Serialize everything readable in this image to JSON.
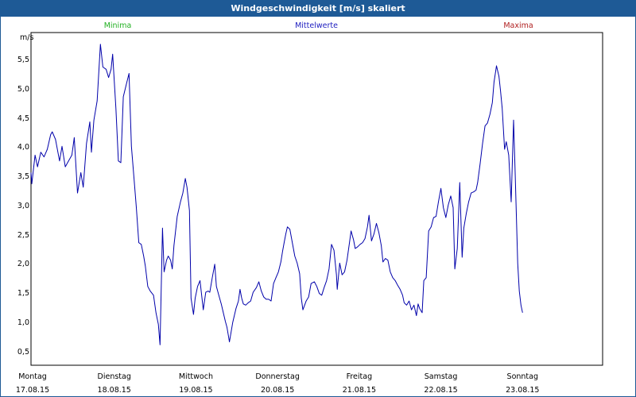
{
  "chart_data": {
    "type": "line",
    "title": "Windgeschwindigkeit [m/s] skaliert",
    "ylabel": "m/s",
    "ylim": [
      0.25,
      5.95
    ],
    "yticks": [
      0.5,
      1.0,
      1.5,
      2.0,
      2.5,
      3.0,
      3.5,
      4.0,
      4.5,
      5.0,
      5.5
    ],
    "ytick_labels": [
      "0,5",
      "1,0",
      "1,5",
      "2,0",
      "2,5",
      "3,0",
      "3,5",
      "4,0",
      "4,5",
      "5,0",
      "5,5"
    ],
    "xlim": [
      0,
      7
    ],
    "x_ticks": [
      {
        "day": "Montag",
        "date": "17.08.15"
      },
      {
        "day": "Dienstag",
        "date": "18.08.15"
      },
      {
        "day": "Mittwoch",
        "date": "19.08.15"
      },
      {
        "day": "Donnerstag",
        "date": "20.08.15"
      },
      {
        "day": "Freitag",
        "date": "21.08.15"
      },
      {
        "day": "Samstag",
        "date": "22.08.15"
      },
      {
        "day": "Sonntag",
        "date": "23.08.15"
      }
    ],
    "legend": [
      {
        "label": "Minima",
        "color": "#22b022"
      },
      {
        "label": "Mittelwerte",
        "color": "#2020c0"
      },
      {
        "label": "Maxima",
        "color": "#b02020"
      }
    ],
    "grid": true,
    "series": [
      {
        "name": "Mittelwerte",
        "color": "#0000aa",
        "points": [
          [
            0.0,
            3.55
          ],
          [
            0.01,
            3.36
          ],
          [
            0.05,
            3.85
          ],
          [
            0.08,
            3.65
          ],
          [
            0.12,
            3.9
          ],
          [
            0.16,
            3.82
          ],
          [
            0.2,
            3.95
          ],
          [
            0.24,
            4.2
          ],
          [
            0.26,
            4.25
          ],
          [
            0.3,
            4.12
          ],
          [
            0.35,
            3.75
          ],
          [
            0.38,
            4.0
          ],
          [
            0.42,
            3.65
          ],
          [
            0.46,
            3.75
          ],
          [
            0.5,
            3.85
          ],
          [
            0.53,
            4.15
          ],
          [
            0.57,
            3.2
          ],
          [
            0.61,
            3.55
          ],
          [
            0.64,
            3.3
          ],
          [
            0.68,
            4.05
          ],
          [
            0.72,
            4.42
          ],
          [
            0.74,
            3.9
          ],
          [
            0.77,
            4.45
          ],
          [
            0.81,
            4.78
          ],
          [
            0.85,
            5.75
          ],
          [
            0.88,
            5.36
          ],
          [
            0.92,
            5.32
          ],
          [
            0.95,
            5.18
          ],
          [
            0.98,
            5.32
          ],
          [
            1.0,
            5.58
          ],
          [
            1.04,
            4.65
          ],
          [
            1.07,
            3.75
          ],
          [
            1.1,
            3.72
          ],
          [
            1.13,
            4.85
          ],
          [
            1.17,
            5.08
          ],
          [
            1.2,
            5.25
          ],
          [
            1.23,
            4.0
          ],
          [
            1.26,
            3.48
          ],
          [
            1.29,
            2.95
          ],
          [
            1.32,
            2.35
          ],
          [
            1.35,
            2.32
          ],
          [
            1.38,
            2.12
          ],
          [
            1.4,
            1.95
          ],
          [
            1.43,
            1.6
          ],
          [
            1.46,
            1.52
          ],
          [
            1.5,
            1.45
          ],
          [
            1.53,
            1.15
          ],
          [
            1.56,
            0.95
          ],
          [
            1.58,
            0.6
          ],
          [
            1.61,
            2.6
          ],
          [
            1.63,
            1.85
          ],
          [
            1.66,
            2.05
          ],
          [
            1.68,
            2.12
          ],
          [
            1.71,
            2.05
          ],
          [
            1.73,
            1.9
          ],
          [
            1.75,
            2.3
          ],
          [
            1.79,
            2.8
          ],
          [
            1.83,
            3.05
          ],
          [
            1.86,
            3.2
          ],
          [
            1.89,
            3.45
          ],
          [
            1.91,
            3.3
          ],
          [
            1.94,
            2.9
          ],
          [
            1.96,
            1.4
          ],
          [
            1.99,
            1.12
          ],
          [
            2.01,
            1.4
          ],
          [
            2.04,
            1.6
          ],
          [
            2.07,
            1.7
          ],
          [
            2.11,
            1.2
          ],
          [
            2.14,
            1.5
          ],
          [
            2.17,
            1.52
          ],
          [
            2.19,
            1.5
          ],
          [
            2.22,
            1.75
          ],
          [
            2.25,
            1.98
          ],
          [
            2.27,
            1.6
          ],
          [
            2.3,
            1.45
          ],
          [
            2.33,
            1.3
          ],
          [
            2.36,
            1.12
          ],
          [
            2.38,
            1.0
          ],
          [
            2.4,
            0.9
          ],
          [
            2.43,
            0.65
          ],
          [
            2.47,
            0.98
          ],
          [
            2.51,
            1.22
          ],
          [
            2.54,
            1.35
          ],
          [
            2.56,
            1.55
          ],
          [
            2.58,
            1.4
          ],
          [
            2.6,
            1.3
          ],
          [
            2.63,
            1.28
          ],
          [
            2.66,
            1.32
          ],
          [
            2.69,
            1.35
          ],
          [
            2.72,
            1.5
          ],
          [
            2.76,
            1.58
          ],
          [
            2.79,
            1.68
          ],
          [
            2.82,
            1.52
          ],
          [
            2.85,
            1.42
          ],
          [
            2.88,
            1.38
          ],
          [
            2.91,
            1.38
          ],
          [
            2.94,
            1.35
          ],
          [
            2.97,
            1.65
          ],
          [
            3.0,
            1.75
          ],
          [
            3.03,
            1.85
          ],
          [
            3.06,
            2.02
          ],
          [
            3.08,
            2.2
          ],
          [
            3.1,
            2.35
          ],
          [
            3.12,
            2.5
          ],
          [
            3.14,
            2.62
          ],
          [
            3.17,
            2.58
          ],
          [
            3.2,
            2.35
          ],
          [
            3.23,
            2.12
          ],
          [
            3.26,
            2.0
          ],
          [
            3.29,
            1.82
          ],
          [
            3.31,
            1.4
          ],
          [
            3.33,
            1.2
          ],
          [
            3.37,
            1.35
          ],
          [
            3.4,
            1.42
          ],
          [
            3.43,
            1.65
          ],
          [
            3.47,
            1.68
          ],
          [
            3.5,
            1.6
          ],
          [
            3.53,
            1.48
          ],
          [
            3.56,
            1.45
          ],
          [
            3.59,
            1.58
          ],
          [
            3.62,
            1.7
          ],
          [
            3.65,
            1.9
          ],
          [
            3.68,
            2.32
          ],
          [
            3.71,
            2.22
          ],
          [
            3.74,
            1.8
          ],
          [
            3.75,
            1.55
          ],
          [
            3.78,
            2.0
          ],
          [
            3.81,
            1.8
          ],
          [
            3.84,
            1.85
          ],
          [
            3.87,
            2.05
          ],
          [
            3.9,
            2.35
          ],
          [
            3.92,
            2.55
          ],
          [
            3.95,
            2.4
          ],
          [
            3.97,
            2.25
          ],
          [
            4.0,
            2.28
          ],
          [
            4.03,
            2.32
          ],
          [
            4.06,
            2.35
          ],
          [
            4.09,
            2.42
          ],
          [
            4.12,
            2.62
          ],
          [
            4.14,
            2.82
          ],
          [
            4.17,
            2.38
          ],
          [
            4.2,
            2.5
          ],
          [
            4.23,
            2.68
          ],
          [
            4.26,
            2.52
          ],
          [
            4.29,
            2.3
          ],
          [
            4.31,
            2.02
          ],
          [
            4.34,
            2.08
          ],
          [
            4.37,
            2.05
          ],
          [
            4.4,
            1.85
          ],
          [
            4.43,
            1.75
          ],
          [
            4.46,
            1.7
          ],
          [
            4.49,
            1.62
          ],
          [
            4.52,
            1.55
          ],
          [
            4.55,
            1.45
          ],
          [
            4.57,
            1.32
          ],
          [
            4.6,
            1.28
          ],
          [
            4.63,
            1.35
          ],
          [
            4.66,
            1.2
          ],
          [
            4.69,
            1.28
          ],
          [
            4.72,
            1.1
          ],
          [
            4.74,
            1.3
          ],
          [
            4.76,
            1.22
          ],
          [
            4.79,
            1.15
          ],
          [
            4.81,
            1.7
          ],
          [
            4.84,
            1.75
          ],
          [
            4.87,
            2.55
          ],
          [
            4.9,
            2.62
          ],
          [
            4.93,
            2.78
          ],
          [
            4.96,
            2.8
          ],
          [
            4.99,
            3.05
          ],
          [
            5.02,
            3.28
          ],
          [
            5.05,
            2.95
          ],
          [
            5.08,
            2.78
          ],
          [
            5.11,
            3.0
          ],
          [
            5.14,
            3.15
          ],
          [
            5.17,
            2.95
          ],
          [
            5.19,
            1.9
          ],
          [
            5.22,
            2.25
          ],
          [
            5.25,
            3.38
          ],
          [
            5.28,
            2.1
          ],
          [
            5.3,
            2.6
          ],
          [
            5.33,
            2.85
          ],
          [
            5.36,
            3.05
          ],
          [
            5.39,
            3.2
          ],
          [
            5.42,
            3.22
          ],
          [
            5.45,
            3.25
          ],
          [
            5.47,
            3.38
          ],
          [
            5.5,
            3.7
          ],
          [
            5.53,
            4.05
          ],
          [
            5.56,
            4.35
          ],
          [
            5.59,
            4.4
          ],
          [
            5.62,
            4.55
          ],
          [
            5.65,
            4.75
          ],
          [
            5.67,
            5.1
          ],
          [
            5.7,
            5.38
          ],
          [
            5.73,
            5.2
          ],
          [
            5.75,
            4.95
          ],
          [
            5.77,
            4.65
          ],
          [
            5.8,
            3.95
          ],
          [
            5.82,
            4.08
          ],
          [
            5.85,
            3.85
          ],
          [
            5.88,
            3.05
          ],
          [
            5.91,
            4.45
          ],
          [
            5.93,
            3.5
          ],
          [
            5.96,
            2.0
          ],
          [
            5.98,
            1.52
          ],
          [
            6.0,
            1.28
          ],
          [
            6.02,
            1.15
          ]
        ]
      }
    ]
  }
}
